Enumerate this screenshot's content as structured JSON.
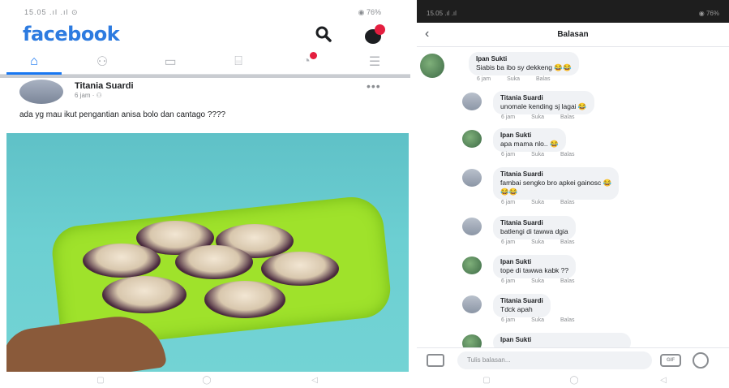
{
  "feed": {
    "status_time": "15.05 .ıl .ıl ⊙",
    "status_battery": "◉ 76%",
    "logo": "facebook",
    "search_icon": "search-icon",
    "messenger_icon": "messenger-icon",
    "nav_tabs": [
      {
        "icon": "home-icon",
        "glyph": "⌂"
      },
      {
        "icon": "friends-icon",
        "glyph": "⚇"
      },
      {
        "icon": "watch-icon",
        "glyph": "▭"
      },
      {
        "icon": "marketplace-icon",
        "glyph": "⌸"
      },
      {
        "icon": "notifications-icon",
        "glyph": "◔"
      },
      {
        "icon": "menu-icon",
        "glyph": "☰"
      }
    ],
    "post": {
      "author": "Titania Suardi",
      "meta": "6 jam · ⚇",
      "more": "•••",
      "text": "ada yg mau ikut pengantian anisa bolo dan cantago ????"
    },
    "system_nav": [
      "▢",
      "◯",
      "◁"
    ]
  },
  "comments_screen": {
    "status_time": "15.05 .ıl .ıl",
    "status_battery": "◉ 76%",
    "back_glyph": "‹",
    "title": "Balasan",
    "comments": [
      {
        "name": "Ipan Sukti",
        "text": "Siabis ba ibo sy dekkeng 😂😂",
        "time": "6 jam",
        "like": "Suka",
        "reply": "Balas"
      },
      {
        "name": "Titania Suardi",
        "text": "unomale kending sj lagai 😂",
        "time": "6 jam",
        "like": "Suka",
        "reply": "Balas"
      },
      {
        "name": "Ipan Sukti",
        "text": "apa mama nlo.. 😂",
        "time": "6 jam",
        "like": "Suka",
        "reply": "Balas"
      },
      {
        "name": "Titania Suardi",
        "text": "fambai sengko bro apkei gainosc 😂",
        "text2": "😂😂",
        "time": "6 jam",
        "like": "Suka",
        "reply": "Balas"
      },
      {
        "name": "Titania Suardi",
        "text": "batlengi di tawwa dgia",
        "time": "6 jam",
        "like": "Suka",
        "reply": "Balas"
      },
      {
        "name": "Ipan Sukti",
        "text": "tope di tawwa kabk ??",
        "time": "6 jam",
        "like": "Suka",
        "reply": "Balas"
      },
      {
        "name": "Titania Suardi",
        "text": "Tdck apah",
        "time": "6 jam",
        "like": "Suka",
        "reply": "Balas"
      },
      {
        "name": "Ipan Sukti",
        "text": ""
      }
    ],
    "input_placeholder": "Tulis balasan...",
    "gif_label": "GIF",
    "system_nav": [
      "▢",
      "◯",
      "◁"
    ]
  }
}
